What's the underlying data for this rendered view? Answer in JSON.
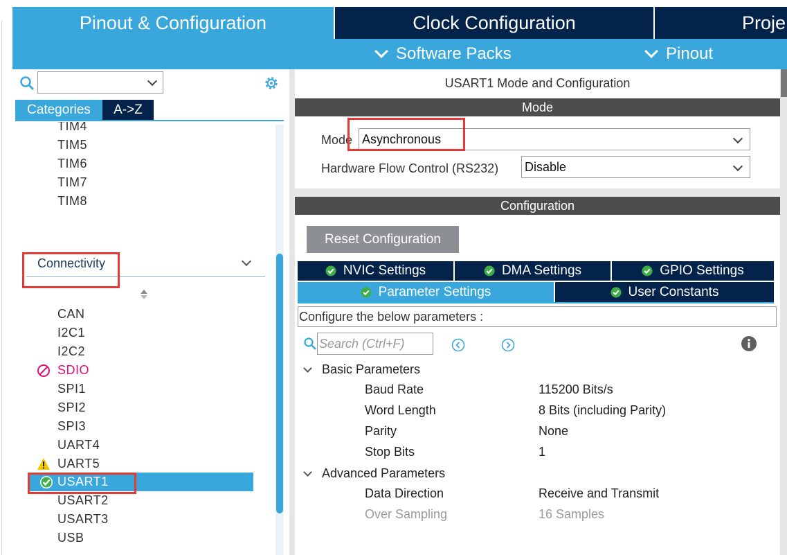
{
  "top_tabs": {
    "pinout": "Pinout & Configuration",
    "clock": "Clock Configuration",
    "project": "Proje"
  },
  "sub_bar": {
    "software_packs": "Software Packs",
    "pinout": "Pinout"
  },
  "sidebar": {
    "search_value": "",
    "category_tab": "Categories",
    "az_tab": "A->Z",
    "timers": [
      "TIM4",
      "TIM5",
      "TIM6",
      "TIM7",
      "TIM8"
    ],
    "connectivity_label": "Connectivity",
    "connectivity_items": [
      {
        "label": "CAN",
        "status": "none"
      },
      {
        "label": "I2C1",
        "status": "none"
      },
      {
        "label": "I2C2",
        "status": "none"
      },
      {
        "label": "SDIO",
        "status": "disabled"
      },
      {
        "label": "SPI1",
        "status": "none"
      },
      {
        "label": "SPI2",
        "status": "none"
      },
      {
        "label": "SPI3",
        "status": "none"
      },
      {
        "label": "UART4",
        "status": "none"
      },
      {
        "label": "UART5",
        "status": "warning"
      },
      {
        "label": "USART1",
        "status": "configured",
        "selected": true
      },
      {
        "label": "USART2",
        "status": "none"
      },
      {
        "label": "USART3",
        "status": "none"
      },
      {
        "label": "USB",
        "status": "none"
      }
    ]
  },
  "panel": {
    "title": "USART1 Mode and Configuration",
    "mode_section": "Mode",
    "mode_label": "Mode",
    "mode_value": "Asynchronous",
    "hw_flow_label": "Hardware Flow Control (RS232)",
    "hw_flow_value": "Disable",
    "config_section": "Configuration",
    "reset_button": "Reset Configuration",
    "tabs": {
      "nvic": "NVIC Settings",
      "dma": "DMA Settings",
      "gpio": "GPIO Settings",
      "parameter": "Parameter Settings",
      "user_constants": "User Constants"
    },
    "configure_text": "Configure the below parameters :",
    "search_placeholder": "Search (Ctrl+F)",
    "basic_group": "Basic Parameters",
    "basic_params": [
      {
        "name": "Baud Rate",
        "value": "115200 Bits/s"
      },
      {
        "name": "Word Length",
        "value": "8 Bits (including Parity)"
      },
      {
        "name": "Parity",
        "value": "None"
      },
      {
        "name": "Stop Bits",
        "value": "1"
      }
    ],
    "advanced_group": "Advanced Parameters",
    "advanced_params": [
      {
        "name": "Data Direction",
        "value": "Receive and Transmit",
        "enabled": true
      },
      {
        "name": "Over Sampling",
        "value": "16 Samples",
        "enabled": false
      }
    ]
  },
  "colors": {
    "accent_blue": "#3aa7dc",
    "navy": "#03234b",
    "section_gray": "#4d4d4d",
    "highlight_red": "#e53935",
    "sdio_pink": "#e0107a",
    "warning_yellow": "#f5c400",
    "check_green": "#3fae49"
  },
  "icons": {
    "search": "search-icon",
    "gear": "gear-icon",
    "disabled": "no-entry-icon",
    "warning": "warning-icon",
    "configured": "check-icon",
    "info": "info-icon",
    "prev": "previous-icon",
    "next": "next-icon"
  }
}
